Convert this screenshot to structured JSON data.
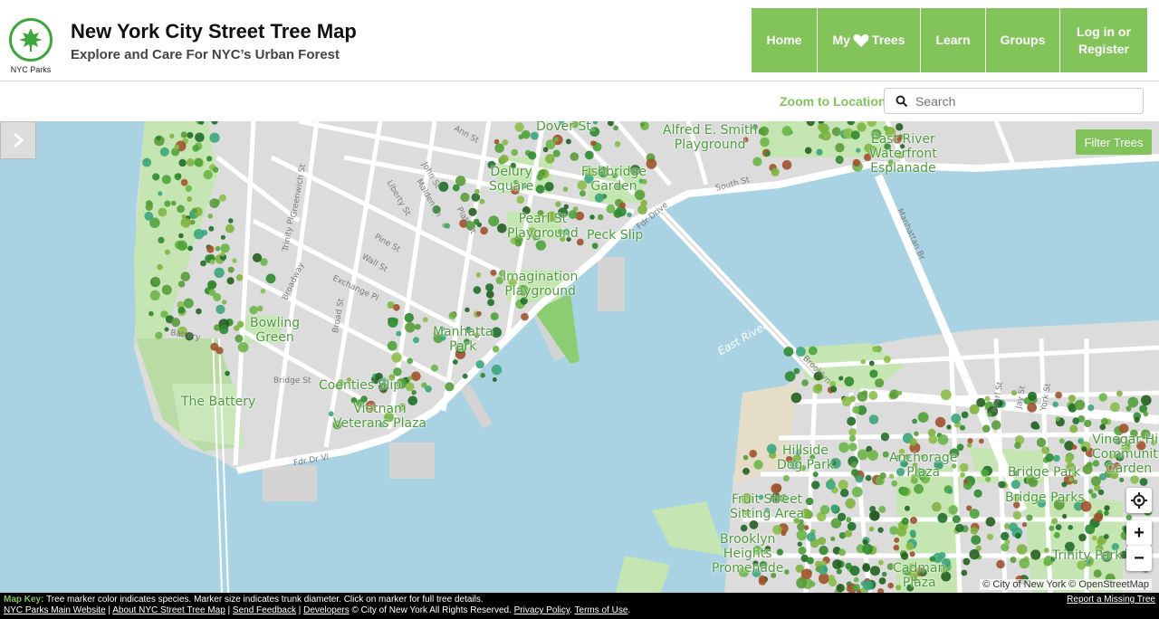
{
  "header": {
    "logo_caption": "NYC Parks",
    "title": "New York City Street Tree Map",
    "subtitle": "Explore and Care For NYC’s Urban Forest"
  },
  "nav": {
    "home": "Home",
    "my": "My",
    "trees": "Trees",
    "learn": "Learn",
    "groups": "Groups",
    "login_line1": "Log in or",
    "login_line2": "Register"
  },
  "subbar": {
    "zoom_label": "Zoom to Location",
    "search_placeholder": "Search"
  },
  "map": {
    "filter_label": "Filter Trees",
    "zoom_in": "+",
    "zoom_out": "−",
    "attribution": "© City of New York © OpenStreetMap",
    "labels": {
      "alfred": "Alfred E. Smith\nPlayground",
      "east_river_esplanade": "East River\nWaterfront\nEsplanade",
      "delury": "Delury\nSquare",
      "fishbridge": "Fishbridge\nGarden",
      "pearl_st_playground": "Pearl St\nPlayground",
      "peck_slip": "Peck Slip",
      "imagination": "Imagination\nPlayground",
      "bowling_green": "Bowling\nGreen",
      "manhattan_park": "Manhatta\nPark",
      "the_battery": "The Battery",
      "coenties_slip": "Coenties Slip",
      "vietnam": "Vietnam\nVeterans Plaza",
      "hillside_dog_park": "Hillside\nDog Park",
      "anchorage_plaza": "Anchorage\nPlaza",
      "bridge_park": "Bridge Park",
      "bridge_parks": "Bridge Parks",
      "vinegar_hill": "Vinegar Hill\nCommunity\nGarden",
      "fruit_street": "Fruit Street\nSitting Area",
      "brooklyn_heights": "Brooklyn\nHeights\nPromenade",
      "brooklyn": "Brooklyn",
      "trinity_park": "Trinity Park",
      "cadman": "Cadman\nPlaza",
      "dover_st": "Dover St.",
      "east_river": "East River"
    },
    "streets": {
      "ann": "Ann St",
      "greenwich": "Greenwich St",
      "trinity_pl": "Trinity Pl",
      "broadway": "Broadway",
      "exchange_pl": "Exchange Pl",
      "broad_st": "Broad St",
      "wall_st": "Wall St",
      "pine_st": "Pine St",
      "liberty_st": "Liberty St",
      "maiden_ln": "Maiden Ln",
      "john_st": "John St",
      "platt_st": "Platt St",
      "bridge_st": "Bridge St",
      "fdr_vi": "Fdr Dr Vi",
      "fdr_drive": "Fdr Drive",
      "south_st": "South St",
      "manhattan_br": "Manhattan Br",
      "brooklyn_br": "Brooklyn",
      "battery": "Battery",
      "pearl": "Pearl St",
      "jay": "Jay St",
      "york": "York St"
    }
  },
  "footer": {
    "key_label": "Map Key:",
    "key_text": "Tree marker color indicates species. Marker size indicates trunk diameter. Click on marker for full tree details.",
    "report": "Report a Missing Tree",
    "links": [
      "NYC Parks Main Website",
      "About NYC Street Tree Map",
      "Send Feedback",
      "Developers"
    ],
    "copyright": "© City of New York All Rights Reserved.",
    "privacy": "Privacy Policy",
    "terms": "Terms of Use"
  },
  "colors": {
    "accent": "#82c35a",
    "water": "#a9d3e3",
    "land": "#dcdcdc",
    "park": "#c5e5b3"
  }
}
